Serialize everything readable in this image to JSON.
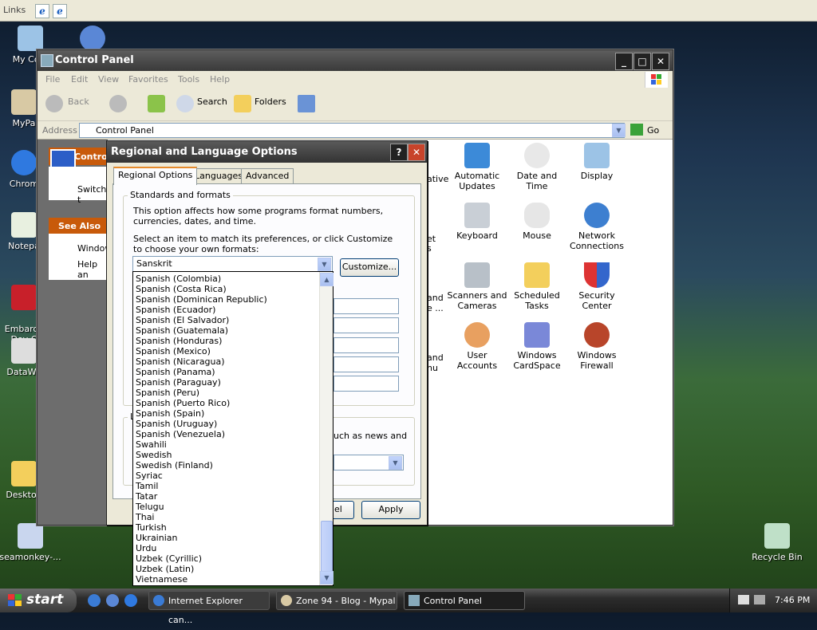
{
  "links_bar": {
    "label": "Links"
  },
  "desktop_icons": [
    {
      "label": "My Com"
    },
    {
      "label": "MyPa"
    },
    {
      "label": "Chrom"
    },
    {
      "label": "Notepa"
    },
    {
      "label": "Embarca\nDev-C"
    },
    {
      "label": "DataWa"
    },
    {
      "label": "Desktop"
    },
    {
      "label": "seamonkey-..."
    },
    {
      "label": "Recycle Bin"
    }
  ],
  "control_panel": {
    "title": "Control Panel",
    "menu": [
      "File",
      "Edit",
      "View",
      "Favorites",
      "Tools",
      "Help"
    ],
    "toolbar": {
      "back": "Back",
      "search": "Search",
      "folders": "Folders"
    },
    "address_label": "Address",
    "address_value": "Control Panel",
    "go_label": "Go",
    "left_pane": {
      "control_heading": "Contro",
      "switch_text": "Switch t",
      "see_also": "See Also",
      "windows_link": "Window",
      "help_link": "Help an"
    },
    "partial_labels": [
      "ative",
      "et",
      "s",
      "and",
      "e ...",
      "and",
      "nu"
    ],
    "icons": [
      {
        "label": "Automatic Updates"
      },
      {
        "label": "Date and Time"
      },
      {
        "label": "Display"
      },
      {
        "label": "Keyboard"
      },
      {
        "label": "Mouse"
      },
      {
        "label": "Network Connections"
      },
      {
        "label": "Scanners and Cameras"
      },
      {
        "label": "Scheduled Tasks"
      },
      {
        "label": "Security Center"
      },
      {
        "label": "User Accounts"
      },
      {
        "label": "Windows CardSpace"
      },
      {
        "label": "Windows Firewall"
      }
    ]
  },
  "dialog": {
    "title": "Regional and Language Options",
    "tabs": [
      "Regional Options",
      "Languages",
      "Advanced"
    ],
    "group_standards": "Standards and formats",
    "desc1": "This option affects how some programs format numbers, currencies, dates, and time.",
    "desc2": "Select an item to match its preferences, or click Customize to choose your own formats:",
    "selected_format": "Sanskrit",
    "customize_button": "Customize...",
    "location_group_initial": "L",
    "location_partial_text": "uch as news and",
    "cancel_partial": "el",
    "apply_button": "Apply",
    "list_items": [
      "Spanish (Colombia)",
      "Spanish (Costa Rica)",
      "Spanish (Dominican Republic)",
      "Spanish (Ecuador)",
      "Spanish (El Salvador)",
      "Spanish (Guatemala)",
      "Spanish (Honduras)",
      "Spanish (Mexico)",
      "Spanish (Nicaragua)",
      "Spanish (Panama)",
      "Spanish (Paraguay)",
      "Spanish (Peru)",
      "Spanish (Puerto Rico)",
      "Spanish (Spain)",
      "Spanish (Uruguay)",
      "Spanish (Venezuela)",
      "Swahili",
      "Swedish",
      "Swedish (Finland)",
      "Syriac",
      "Tamil",
      "Tatar",
      "Telugu",
      "Thai",
      "Turkish",
      "Ukrainian",
      "Urdu",
      "Uzbek (Cyrillic)",
      "Uzbek (Latin)",
      "Vietnamese"
    ]
  },
  "taskbar": {
    "start_label": "start",
    "tasks": [
      {
        "label": "Internet Explorer can..."
      },
      {
        "label": "Zone 94 - Blog - Mypal"
      },
      {
        "label": "Control Panel"
      }
    ],
    "clock": "7:46 PM"
  }
}
